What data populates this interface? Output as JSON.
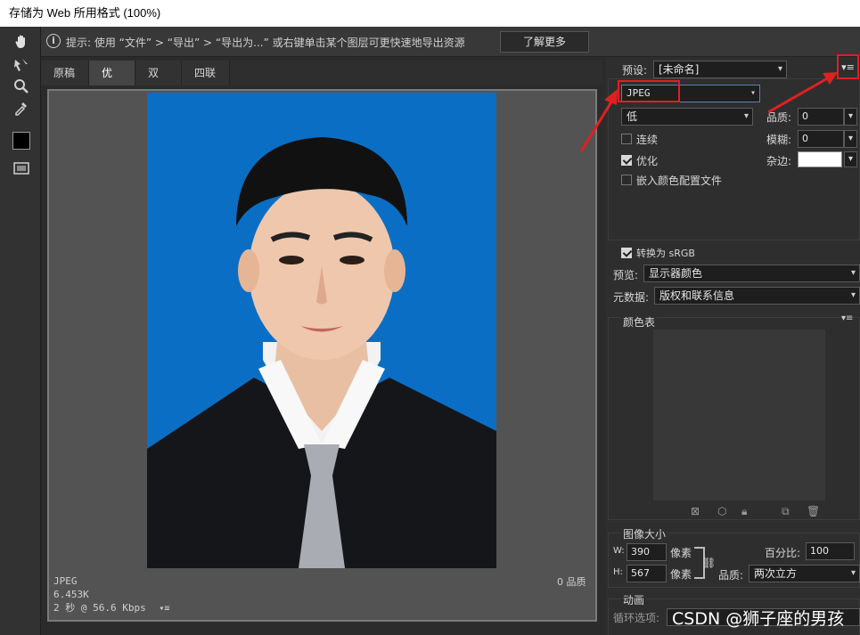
{
  "window": {
    "title": "存储为 Web 所用格式 (100%)"
  },
  "hint": {
    "text": "提示: 使用 “文件” > “导出” > “导出为...” 或右键单击某个图层可更快速地导出资源",
    "learn_more": "了解更多"
  },
  "tabs": [
    {
      "label": "原稿",
      "active": false
    },
    {
      "label": "优化",
      "active": true
    },
    {
      "label": "双联",
      "active": false
    },
    {
      "label": "四联",
      "active": false
    }
  ],
  "image_info": {
    "format": "JPEG",
    "size": "6.453K",
    "time": "2 秒 @ 56.6 Kbps",
    "quality": "0 品质"
  },
  "settings": {
    "preset_label": "预设:",
    "preset_value": "[未命名]",
    "format_value": "JPEG",
    "quality_level": "低",
    "quality_label": "品质:",
    "quality_value": "0",
    "progressive_label": "连续",
    "progressive_checked": false,
    "blur_label": "模糊:",
    "blur_value": "0",
    "optimized_label": "优化",
    "optimized_checked": true,
    "matte_label": "杂边:",
    "embed_profile_label": "嵌入颜色配置文件",
    "embed_profile_checked": false,
    "convert_srgb_label": "转换为 sRGB",
    "convert_srgb_checked": true,
    "preview_label": "预览:",
    "preview_value": "显示器颜色",
    "metadata_label": "元数据:",
    "metadata_value": "版权和联系信息"
  },
  "color_table": {
    "title": "颜色表"
  },
  "image_size": {
    "title": "图像大小",
    "w_label": "W:",
    "w_value": "390",
    "h_label": "H:",
    "h_value": "567",
    "unit": "像素",
    "percent_label": "百分比:",
    "percent_value": "100",
    "quality_label": "品质:",
    "quality_value": "两次立方"
  },
  "animation": {
    "title": "动画",
    "loop_label": "循环选项:"
  },
  "watermark": "CSDN @狮子座的男孩",
  "colors": {
    "accent_red": "#e02020",
    "photo_bg": "#0a6fc4"
  }
}
